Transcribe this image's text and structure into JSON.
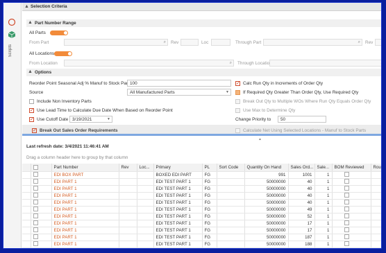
{
  "rail": {
    "icon1": "compass-icon",
    "icon2": "cube-icon",
    "label": "Scripts"
  },
  "selection": {
    "title": "Selection Criteria"
  },
  "part_range": {
    "title": "Part Number Range",
    "all_parts_label": "All Parts",
    "from_part_label": "From Part",
    "rev_label": "Rev",
    "loc_label": "Loc",
    "through_part_label": "Through Part",
    "rev2_label": "Rev",
    "all_locations_label": "All Locations",
    "from_location_label": "From Location",
    "through_location_label": "Through Location"
  },
  "options": {
    "title": "Options",
    "reorder_label": "Reorder Point Seasonal Adj % Manuf to Stock Parts",
    "reorder_value": "100",
    "calc_run_qty_label": "Calc Run Qty in Increments of Order Qty",
    "source_label": "Source",
    "source_value": "All Manufactured Parts",
    "if_required_label": "If Required Qty Greater Than Order Qty, Use Required Qty",
    "include_non_inventory_label": "Include Non Inventory Parts",
    "break_out_qty_label": "Break Out Qty to Multiple WOs Where Run Qty Equals Order Qty",
    "use_lead_time_label": "Use Lead Time to Calculate Due Date When Based on Reorder Point",
    "use_max_label": "Use Max to Determine Qty",
    "use_cutoff_label": "Use Cutoff Date",
    "cutoff_value": "3/19/2021",
    "change_priority_label": "Change Priority to",
    "change_priority_value": "50",
    "break_out_sales_label": "Break Out Sales Order Requirements",
    "calc_net_label": "Calculate Net Using Selected Locations - Manuf to Stock Parts"
  },
  "refresh": {
    "text": "Last refresh date: 3/4/2021 11:46:41 AM"
  },
  "grid": {
    "drag_hint": "Drag a column header here to group by that column",
    "columns": [
      "",
      "Part Number",
      "Rev",
      "Loc...",
      "Primary",
      "PL",
      "Sort Code",
      "Quantity On Hand",
      "Sales Ord...",
      "Sale...",
      "BOM Reviewed",
      "Router Reviewed"
    ],
    "rows": [
      {
        "part": "EDI BOX PART",
        "primary": "BOXED EDI PART",
        "pl": "FG",
        "qoh": "991",
        "so": "1001",
        "sale": "1"
      },
      {
        "part": "EDI PART 1",
        "primary": "EDI TEST PART 1",
        "pl": "FG",
        "qoh": "50000000",
        "so": "40",
        "sale": "1"
      },
      {
        "part": "EDI PART 1",
        "primary": "EDI TEST PART 1",
        "pl": "FG",
        "qoh": "50000000",
        "so": "40",
        "sale": "1"
      },
      {
        "part": "EDI PART 1",
        "primary": "EDI TEST PART 1",
        "pl": "FG",
        "qoh": "50000000",
        "so": "40",
        "sale": "1"
      },
      {
        "part": "EDI PART 1",
        "primary": "EDI TEST PART 1",
        "pl": "FG",
        "qoh": "50000000",
        "so": "40",
        "sale": "1"
      },
      {
        "part": "EDI PART 1",
        "primary": "EDI TEST PART 1",
        "pl": "FG",
        "qoh": "50000000",
        "so": "49",
        "sale": "1"
      },
      {
        "part": "EDI PART 1",
        "primary": "EDI TEST PART 1",
        "pl": "FG",
        "qoh": "50000000",
        "so": "52",
        "sale": "1"
      },
      {
        "part": "EDI PART 1",
        "primary": "EDI TEST PART 1",
        "pl": "FG",
        "qoh": "50000000",
        "so": "17",
        "sale": "1"
      },
      {
        "part": "EDI PART 1",
        "primary": "EDI TEST PART 1",
        "pl": "FG",
        "qoh": "50000000",
        "so": "17",
        "sale": "1"
      },
      {
        "part": "EDI PART 1",
        "primary": "EDI TEST PART 1",
        "pl": "FG",
        "qoh": "50000000",
        "so": "187",
        "sale": "1"
      },
      {
        "part": "EDI PART 1",
        "primary": "EDI TEST PART 1",
        "pl": "FG",
        "qoh": "50000000",
        "so": "188",
        "sale": "1"
      }
    ]
  },
  "colors": {
    "accent": "#f28b3a",
    "part_link": "#d35a1e",
    "frame": "#0a1e9e"
  }
}
